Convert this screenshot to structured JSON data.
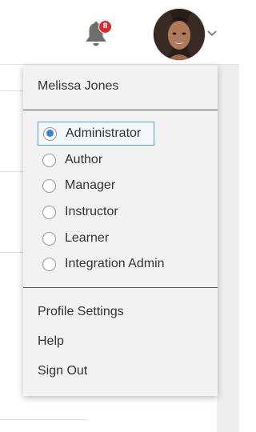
{
  "header": {
    "notification_count": "8",
    "bell_icon": "bell-icon",
    "chevron_icon": "chevron-down-icon"
  },
  "menu": {
    "user_name": "Melissa Jones",
    "roles": [
      {
        "label": "Administrator",
        "selected": true
      },
      {
        "label": "Author",
        "selected": false
      },
      {
        "label": "Manager",
        "selected": false
      },
      {
        "label": "Instructor",
        "selected": false
      },
      {
        "label": "Learner",
        "selected": false
      },
      {
        "label": "Integration Admin",
        "selected": false
      }
    ],
    "links": {
      "profile": "Profile Settings",
      "help": "Help",
      "signout": "Sign Out"
    }
  },
  "colors": {
    "badge": "#e0262a",
    "radio_selected": "#3b82d1",
    "focus_border": "#5a9bdc"
  }
}
